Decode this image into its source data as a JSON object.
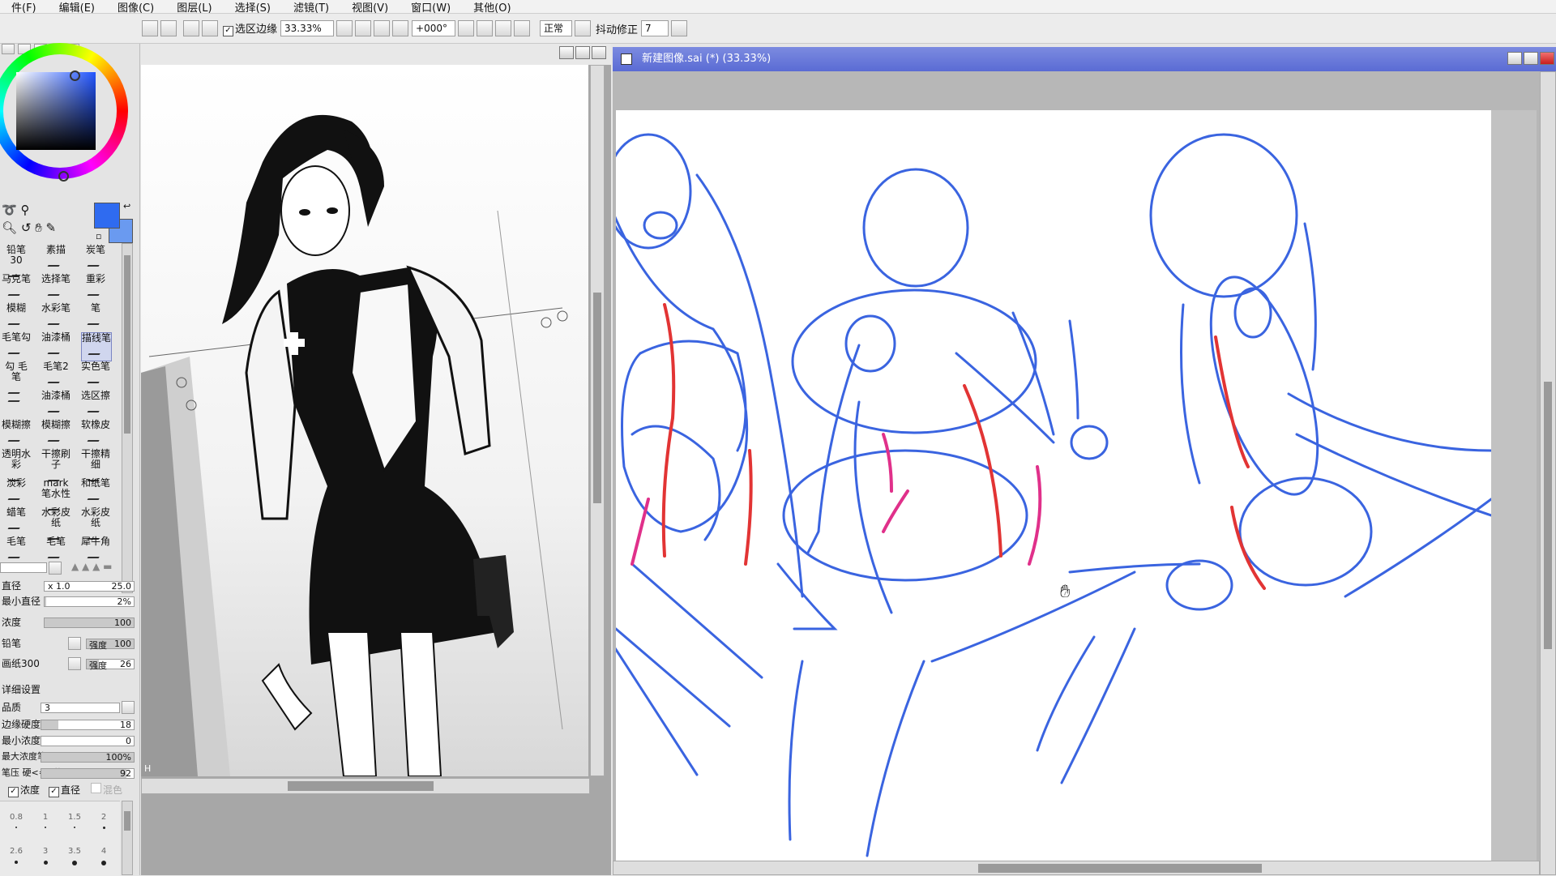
{
  "menu": [
    "件(F)",
    "编辑(E)",
    "图像(C)",
    "图层(L)",
    "选择(S)",
    "滤镜(T)",
    "视图(V)",
    "窗口(W)",
    "其他(O)"
  ],
  "toolbar": {
    "selection_edge": "选区边缘",
    "zoom": "33.33%",
    "rotation": "+000°",
    "blend_mode": "正常",
    "stabilizer_label": "抖动修正",
    "stabilizer_value": "7"
  },
  "brushes": [
    [
      "铅笔30",
      "素描",
      "炭笔"
    ],
    [
      "马克笔",
      "选择笔",
      "重彩"
    ],
    [
      "模糊",
      "水彩笔",
      "笔"
    ],
    [
      "毛笔勾",
      "油漆桶",
      "描线笔"
    ],
    [
      "勾 毛笔",
      "毛笔2",
      "实色笔"
    ],
    [
      "",
      "油漆桶",
      "选区擦"
    ],
    [
      "模糊擦",
      "模糊擦",
      "软橡皮"
    ],
    [
      "透明水彩",
      "干擦刷子",
      "干擦精细"
    ],
    [
      "淡彩",
      "mark笔水性",
      "和纸笔"
    ],
    [
      "蜡笔",
      "水彩皮纸",
      "水彩皮纸"
    ],
    [
      "毛笔",
      "毛笔",
      "犀牛角"
    ]
  ],
  "params": {
    "size_label": "直径",
    "size_mult": "x 1.0",
    "size_val": "25.0",
    "min_size_label": "最小直径",
    "min_size_val": "2%",
    "density_label": "浓度",
    "density_val": "100",
    "shape_label": "铅笔",
    "shape_val_label": "强度",
    "shape_val": "100",
    "texture_label": "画纸300",
    "texture_val_label": "强度",
    "texture_val": "26",
    "advanced_label": "详细设置",
    "quality_label": "品质",
    "quality_val": "3",
    "edge_label": "边缘硬度",
    "edge_val": "18",
    "min_density_label": "最小浓度",
    "min_density_val": "0",
    "max_pressure_label": "最大浓度笔压",
    "max_pressure_val": "100%",
    "hard_soft_label": "笔压 硬<=>软",
    "hard_soft_val": "92",
    "check_density": "浓度",
    "check_size": "直径",
    "check_blend": "混色"
  },
  "dot_sizes": [
    "0.8",
    "1",
    "1.5",
    "2",
    "2.6",
    "3",
    "3.5",
    "4"
  ],
  "canvas": {
    "title": "新建图像.sai (*) (33.33%)"
  },
  "colors": {
    "primary": "#2f6bf0",
    "sketch_blue": "#3a64e0",
    "sketch_red": "#e23434",
    "sketch_magenta": "#e0308a"
  }
}
